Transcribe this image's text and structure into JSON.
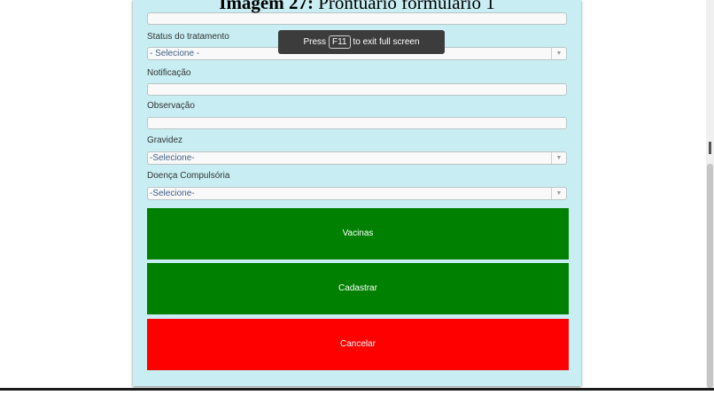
{
  "caption": {
    "prefix": "Imagem 27:",
    "text": " Prontuário formulário 1"
  },
  "form": {
    "status": {
      "label": "Status do tratamento",
      "value": "- Selecione -"
    },
    "notificacao": {
      "label": "Notificação",
      "value": ""
    },
    "observacao": {
      "label": "Observação",
      "value": ""
    },
    "gravidez": {
      "label": "Gravidez",
      "value": "-Selecione-"
    },
    "doenca": {
      "label": "Doença Compulsória",
      "value": "-Selecione-"
    }
  },
  "buttons": {
    "vacinas": "Vacinas",
    "cadastrar": "Cadastrar",
    "cancelar": "Cancelar"
  },
  "toast": {
    "before": "Press",
    "key": "F11",
    "after": "to exit full screen"
  },
  "colors": {
    "panel": "#c8eef3",
    "primary_button": "#008000",
    "danger_button": "#ff0000"
  },
  "icons": {
    "select_arrow": "▼"
  }
}
